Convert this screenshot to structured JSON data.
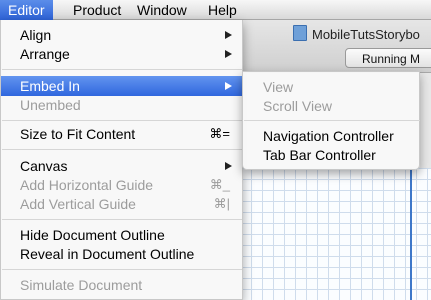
{
  "menubar": {
    "items": [
      {
        "label": "Editor"
      },
      {
        "label": "Product"
      },
      {
        "label": "Window"
      },
      {
        "label": "Help"
      }
    ]
  },
  "background": {
    "window_title": "MobileTutsStorybo",
    "status": "Running M"
  },
  "editor_menu": {
    "align": "Align",
    "arrange": "Arrange",
    "embed_in": "Embed In",
    "unembed": "Unembed",
    "size_to_fit": "Size to Fit Content",
    "size_to_fit_shortcut": "⌘=",
    "canvas": "Canvas",
    "add_horizontal_guide": "Add Horizontal Guide",
    "add_horizontal_guide_shortcut": "⌘_",
    "add_vertical_guide": "Add Vertical Guide",
    "add_vertical_guide_shortcut": "⌘|",
    "hide_document_outline": "Hide Document Outline",
    "reveal_in_document_outline": "Reveal in Document Outline",
    "simulate_document": "Simulate Document"
  },
  "embed_submenu": {
    "view": "View",
    "scroll_view": "Scroll View",
    "navigation_controller": "Navigation Controller",
    "tab_bar_controller": "Tab Bar Controller"
  }
}
